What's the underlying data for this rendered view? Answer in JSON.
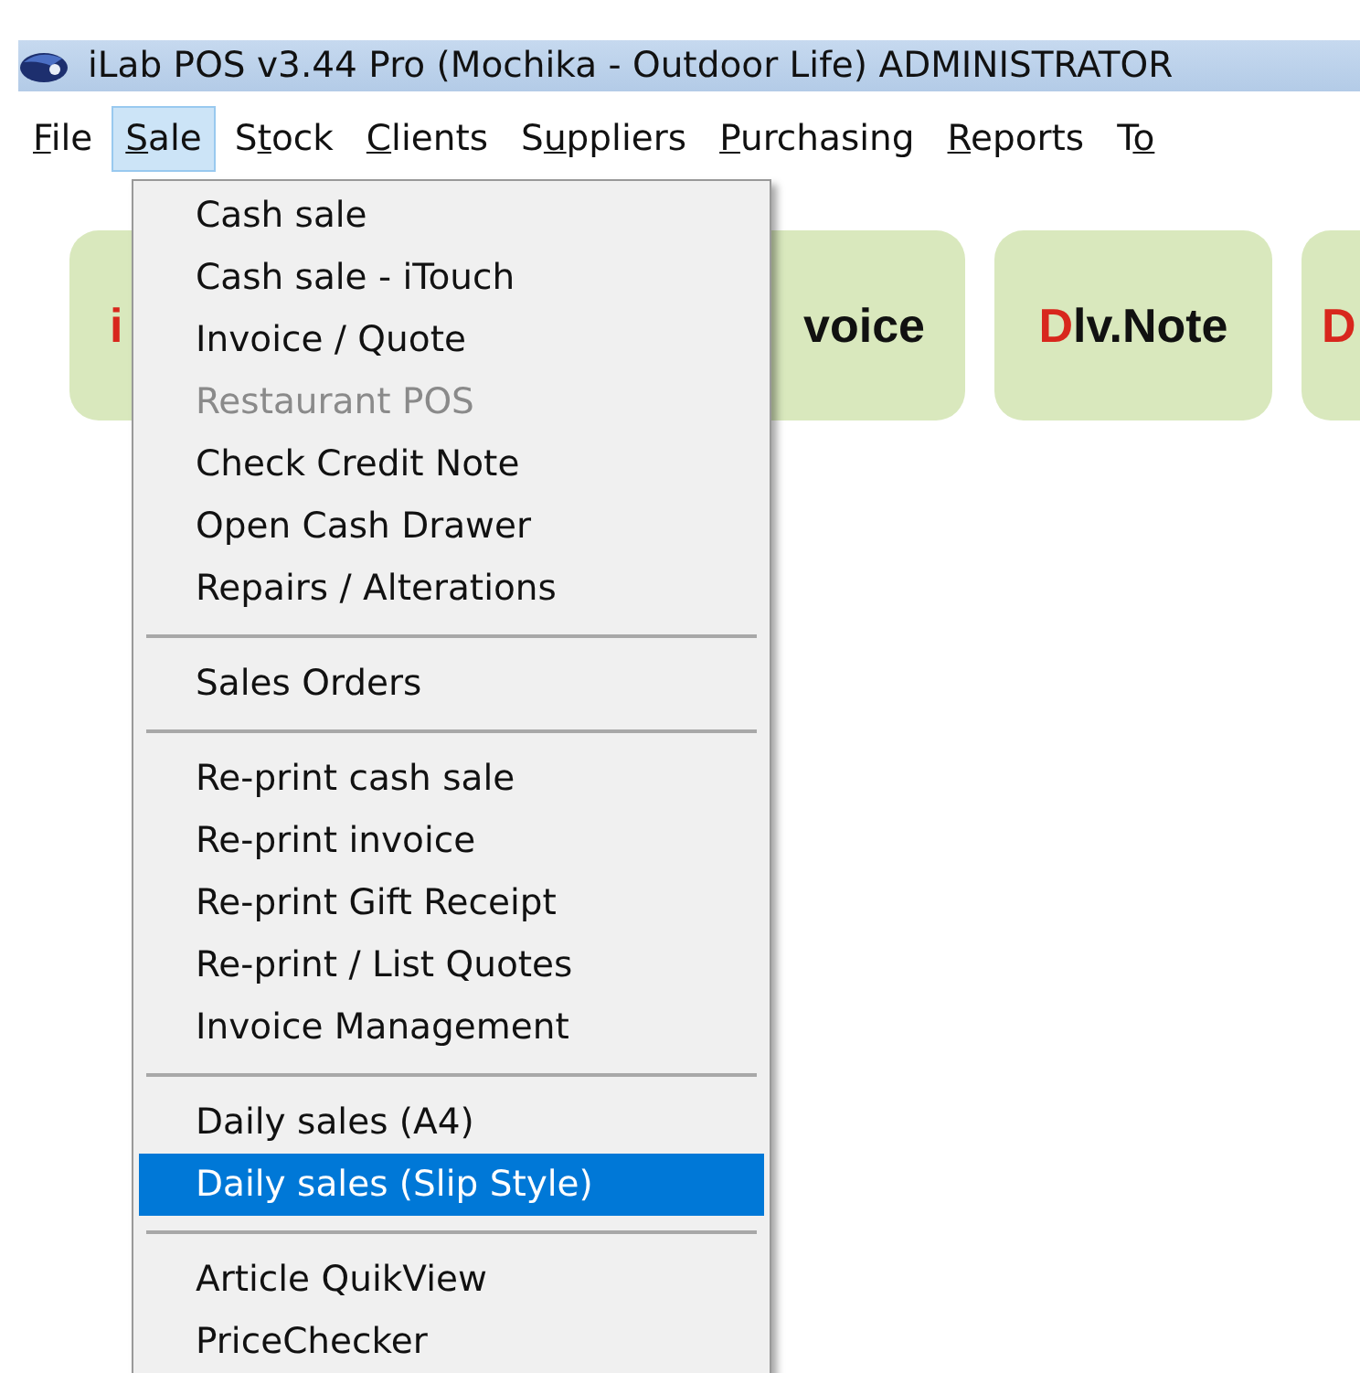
{
  "window": {
    "title": "iLab POS v3.44 Pro (Mochika - Outdoor Life) ADMINISTRATOR"
  },
  "menu_bar": [
    {
      "key": "F",
      "post": "ile",
      "selected": false
    },
    {
      "key": "S",
      "post": "ale",
      "selected": true
    },
    {
      "pre": "S",
      "key": "t",
      "post": "ock",
      "selected": false
    },
    {
      "key": "C",
      "post": "lients",
      "selected": false
    },
    {
      "pre": "S",
      "key": "u",
      "post": "ppliers",
      "selected": false
    },
    {
      "key": "P",
      "post": "urchasing",
      "selected": false
    },
    {
      "key": "R",
      "post": "eports",
      "selected": false
    },
    {
      "pre": "T",
      "key": "o",
      "selected": false
    }
  ],
  "tiles": [
    {
      "key": "i"
    },
    {
      "rest": "voice"
    },
    {
      "key": "D",
      "rest": "lv.Note"
    },
    {
      "key": "D"
    }
  ],
  "sale_menu": [
    {
      "kind": "item",
      "label": "Cash sale",
      "disabled": false,
      "selected": false
    },
    {
      "kind": "item",
      "label": "Cash sale - iTouch",
      "disabled": false,
      "selected": false
    },
    {
      "kind": "item",
      "label": "Invoice / Quote",
      "disabled": false,
      "selected": false
    },
    {
      "kind": "item",
      "label": "Restaurant POS",
      "disabled": true,
      "selected": false
    },
    {
      "kind": "item",
      "label": "Check Credit Note",
      "disabled": false,
      "selected": false
    },
    {
      "kind": "item",
      "label": "Open Cash Drawer",
      "disabled": false,
      "selected": false
    },
    {
      "kind": "item",
      "label": "Repairs / Alterations",
      "disabled": false,
      "selected": false
    },
    {
      "kind": "separator"
    },
    {
      "kind": "item",
      "label": "Sales Orders",
      "disabled": false,
      "selected": false
    },
    {
      "kind": "separator"
    },
    {
      "kind": "item",
      "label": "Re-print cash sale",
      "disabled": false,
      "selected": false
    },
    {
      "kind": "item",
      "label": "Re-print invoice",
      "disabled": false,
      "selected": false
    },
    {
      "kind": "item",
      "label": "Re-print Gift Receipt",
      "disabled": false,
      "selected": false
    },
    {
      "kind": "item",
      "label": "Re-print / List Quotes",
      "disabled": false,
      "selected": false
    },
    {
      "kind": "item",
      "label": "Invoice Management",
      "disabled": false,
      "selected": false
    },
    {
      "kind": "separator"
    },
    {
      "kind": "item",
      "label": "Daily sales (A4)",
      "disabled": false,
      "selected": false
    },
    {
      "kind": "item",
      "label": "Daily sales (Slip Style)",
      "disabled": false,
      "selected": true
    },
    {
      "kind": "separator"
    },
    {
      "kind": "item",
      "label": "Article QuikView",
      "disabled": false,
      "selected": false
    },
    {
      "kind": "item",
      "label": "PriceChecker",
      "disabled": false,
      "selected": false
    }
  ]
}
